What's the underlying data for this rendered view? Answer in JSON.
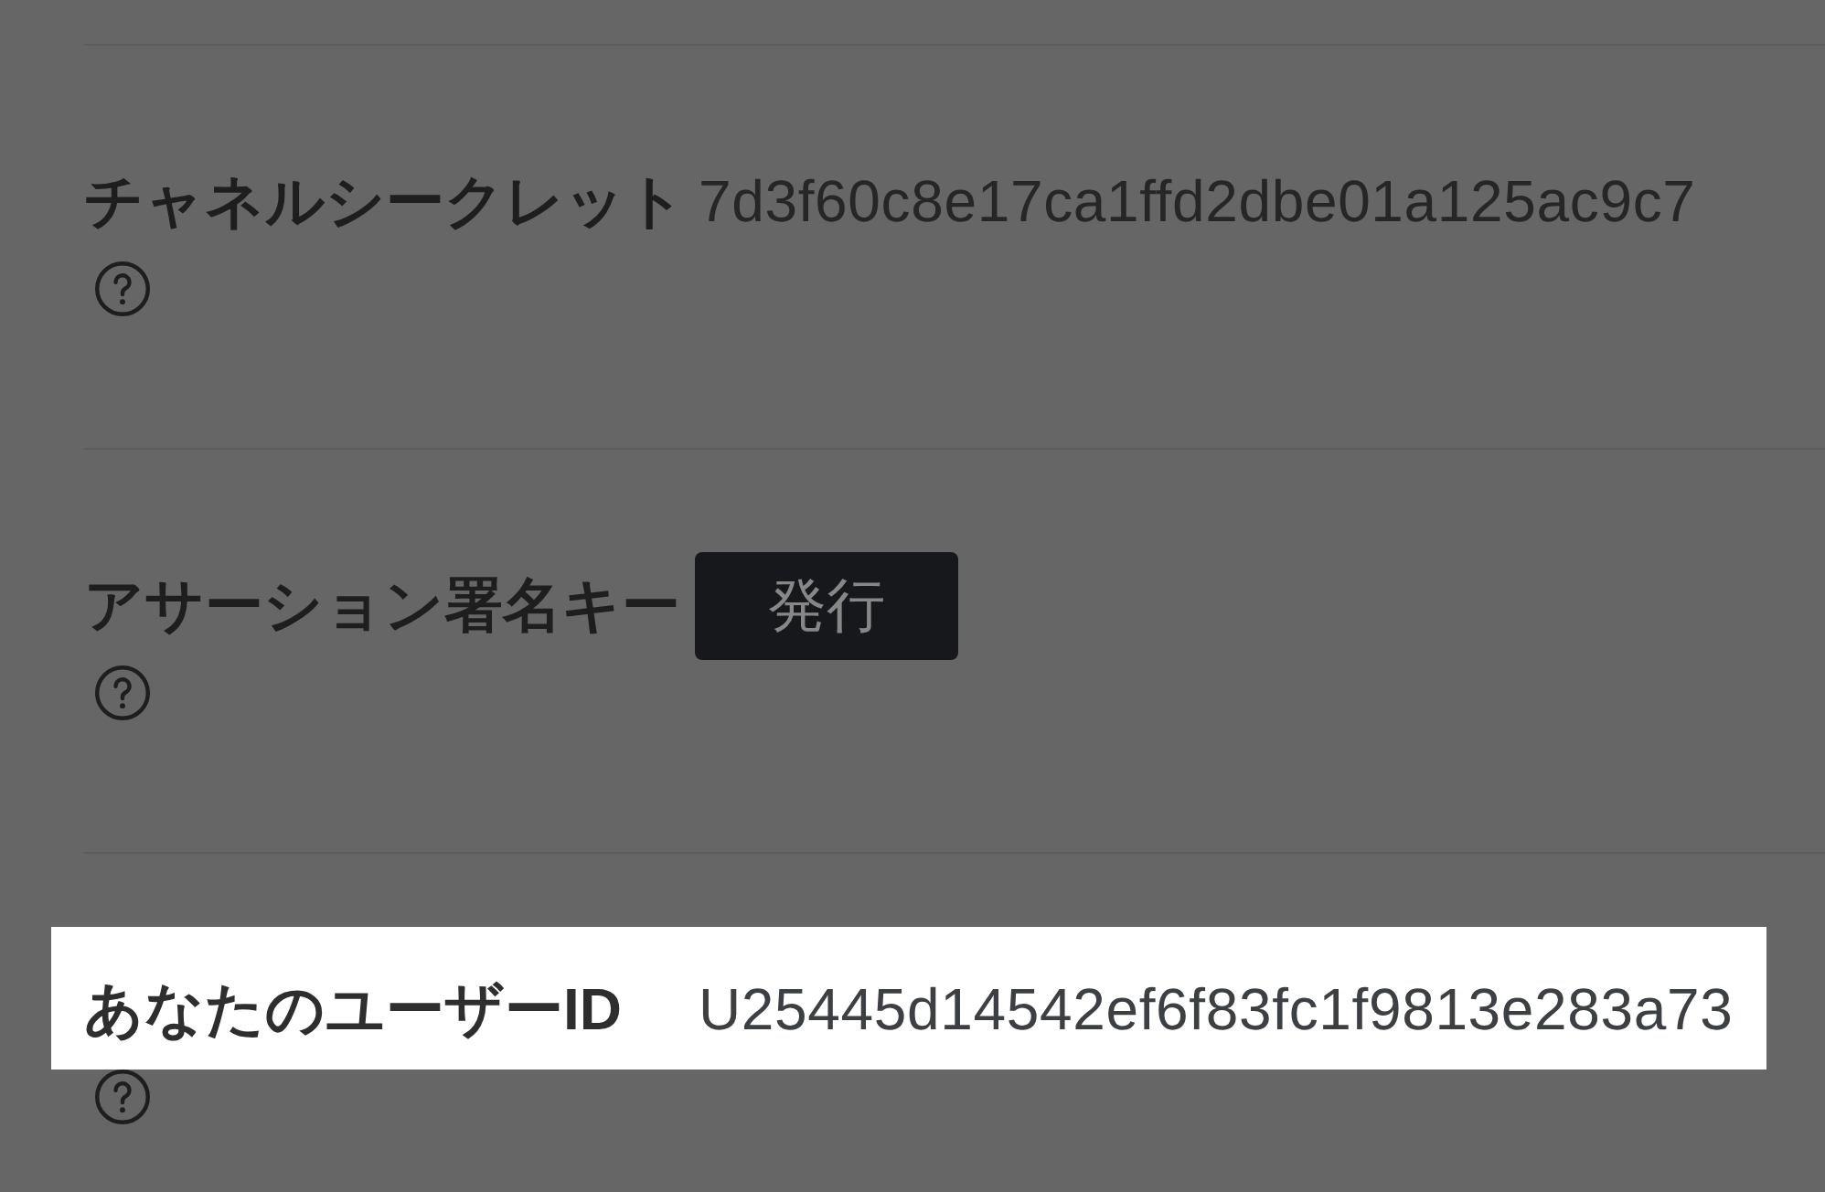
{
  "rows": [
    {
      "kind": "text",
      "label": "チャネルシークレット",
      "value": "7d3f60c8e17ca1ffd2dbe01a125ac9c7",
      "highlighted": false
    },
    {
      "kind": "button",
      "label": "アサーション署名キー",
      "button": "発行",
      "highlighted": false
    },
    {
      "kind": "text",
      "label": "あなたのユーザーID",
      "value": "U25445d14542ef6f83fc1f9813e283a73",
      "highlighted": true
    }
  ]
}
